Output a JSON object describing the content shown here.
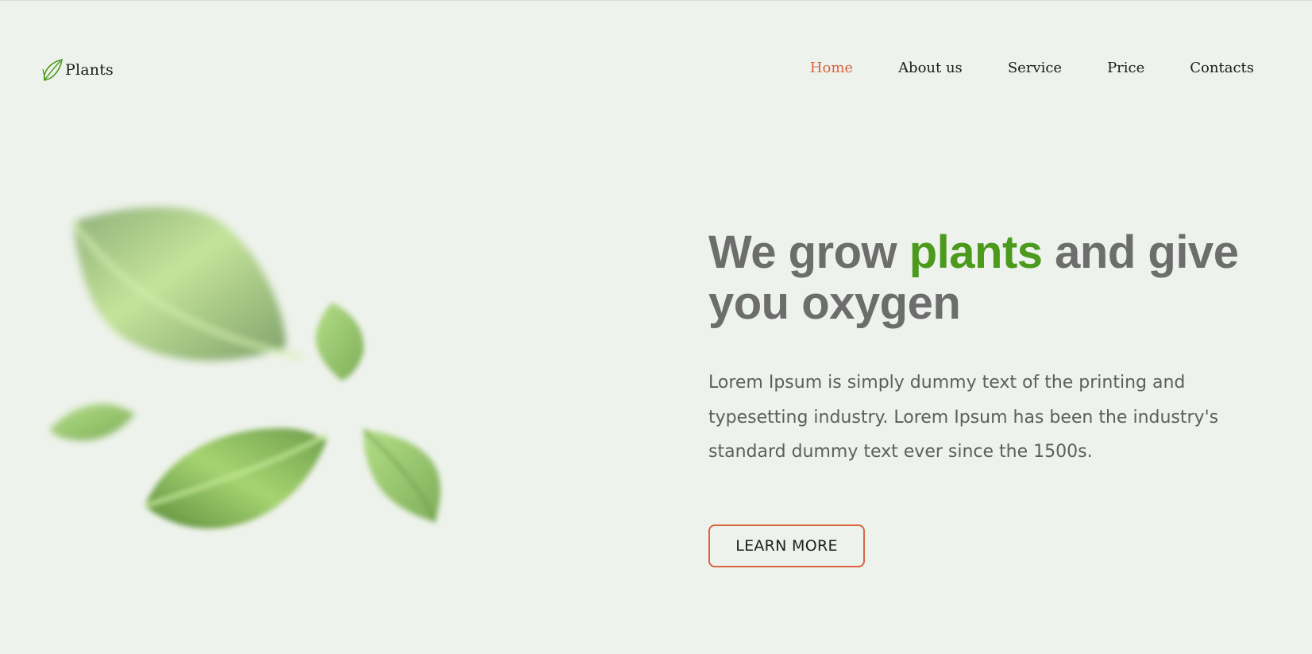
{
  "header": {
    "logo_text": "Plants",
    "logo_icon": "leaf-icon",
    "nav": [
      {
        "label": "Home",
        "active": true
      },
      {
        "label": "About us",
        "active": false
      },
      {
        "label": "Service",
        "active": false
      },
      {
        "label": "Price",
        "active": false
      },
      {
        "label": "Contacts",
        "active": false
      }
    ]
  },
  "hero": {
    "title_part1": "We grow ",
    "title_accent": "plants",
    "title_part2": " and give you oxygen",
    "description": "Lorem Ipsum is simply dummy text of the printing and typesetting industry. Lorem Ipsum has been the industry's standard dummy text ever since the 1500s.",
    "cta_label": "LEARN MORE"
  },
  "colors": {
    "background": "#eef2ec",
    "accent_green": "#4c9a1c",
    "accent_orange": "#d9643f",
    "heading_gray": "#6d6d6d"
  }
}
